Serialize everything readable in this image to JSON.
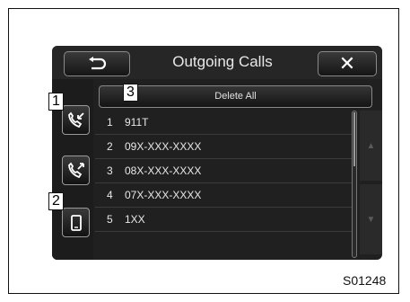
{
  "header": {
    "title": "Outgoing Calls",
    "close_label": "✕"
  },
  "actions": {
    "delete_all_label": "Delete All"
  },
  "callouts": {
    "c1": "1",
    "c2": "2",
    "c3": "3"
  },
  "calls": [
    {
      "num": "1",
      "value": "911T"
    },
    {
      "num": "2",
      "value": "09X-XXX-XXXX"
    },
    {
      "num": "3",
      "value": "08X-XXX-XXXX"
    },
    {
      "num": "4",
      "value": "07X-XXX-XXXX"
    },
    {
      "num": "5",
      "value": "1XX"
    }
  ],
  "scroll": {
    "up_icon": "▲",
    "down_icon": "▼"
  },
  "figure_code": "S01248",
  "icons": {
    "back": "return-arrow-icon",
    "incoming": "incoming-call-icon",
    "outgoing": "outgoing-call-icon",
    "phone": "mobile-phone-icon"
  }
}
